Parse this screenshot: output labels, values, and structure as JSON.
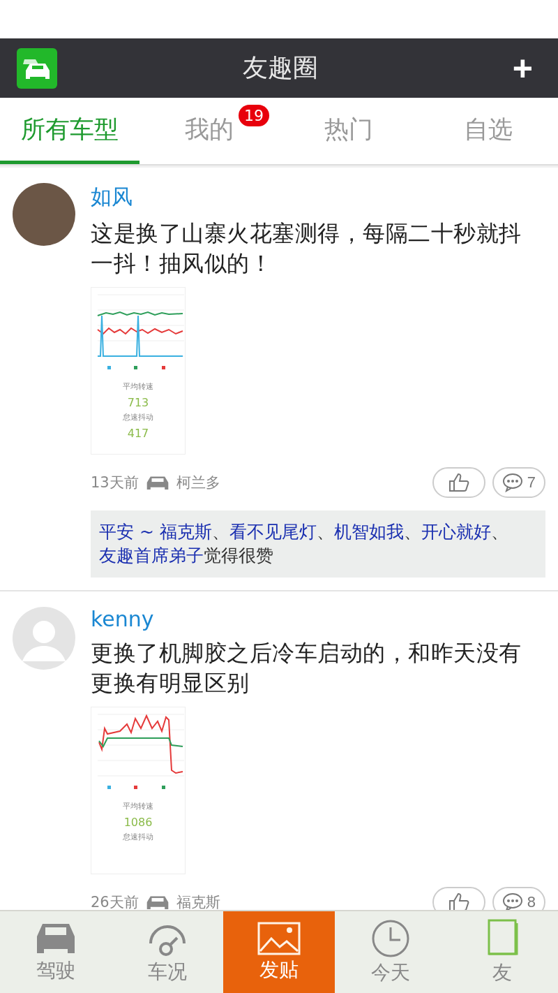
{
  "header": {
    "title": "友趣圈",
    "add_label": "+"
  },
  "tabs": [
    {
      "label": "所有车型",
      "selected": true
    },
    {
      "label": "我的",
      "selected": false,
      "badge": "19"
    },
    {
      "label": "热门",
      "selected": false
    },
    {
      "label": "自选",
      "selected": false
    }
  ],
  "posts": [
    {
      "author": "如风",
      "avatar": {
        "kind": "photo"
      },
      "text": "这是换了山寨火花塞测得，每隔二十秒就抖一抖！抽风似的！",
      "thumbnail": {
        "kind": "idle",
        "stat_1_label": "平均转速",
        "stat_1_value": "713",
        "stat_2_label": "怠速抖动",
        "stat_2_value": "417"
      },
      "time": "13天前",
      "car": "柯兰多",
      "comments": "7",
      "likes": {
        "names": [
          "平安 ~ 福克斯",
          "看不见尾灯",
          "机智如我",
          "开心就好",
          "友趣首席弟子"
        ],
        "separator": "、",
        "suffix": "觉得很赞"
      }
    },
    {
      "author": "kenny",
      "avatar": {
        "kind": "default"
      },
      "text": "更换了机脚胶之后冷车启动的，和昨天没有更换有明显区别",
      "thumbnail": {
        "kind": "cold",
        "stat_1_label": "平均转速",
        "stat_1_value": "1086",
        "stat_2_label": "怠速抖动"
      },
      "time": "26天前",
      "car": "福克斯",
      "comments": "8"
    }
  ],
  "nav": [
    {
      "label": "驾驶",
      "kind": "car",
      "selected": false
    },
    {
      "label": "车况",
      "kind": "gauge",
      "selected": false
    },
    {
      "label": "发贴",
      "kind": "image",
      "selected": true
    },
    {
      "label": "今天",
      "kind": "clock",
      "selected": false
    },
    {
      "label": "友",
      "kind": "book",
      "selected": false
    }
  ]
}
